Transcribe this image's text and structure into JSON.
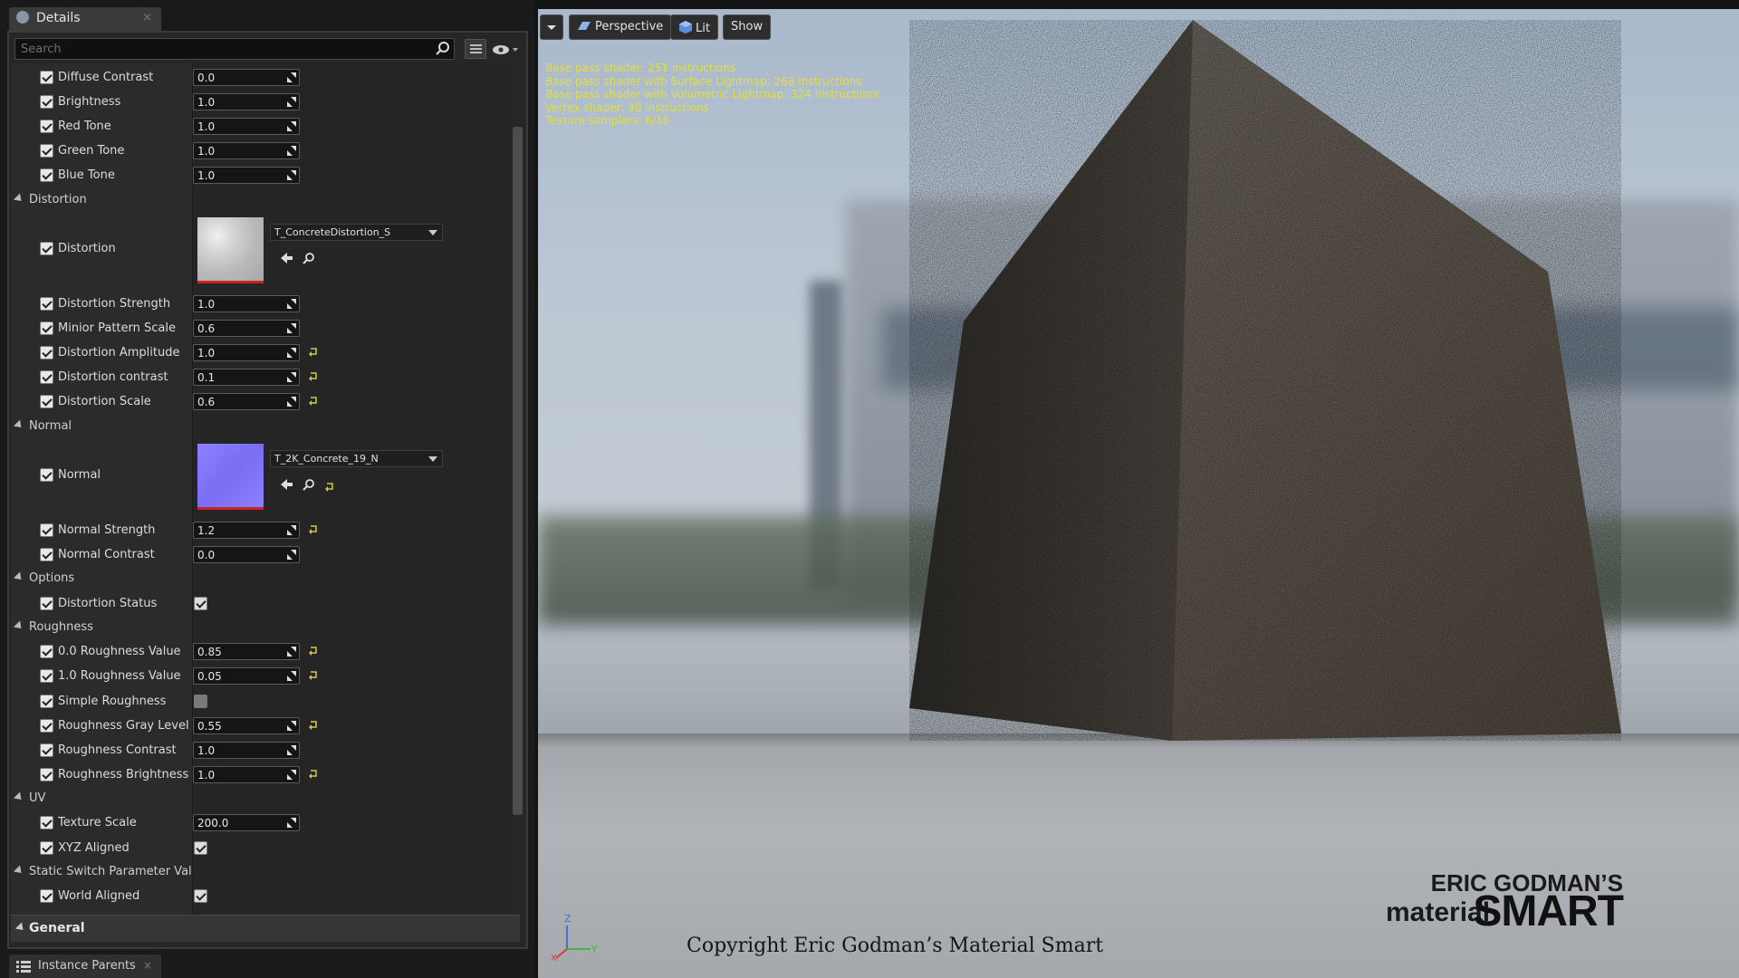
{
  "details_tab": {
    "title": "Details",
    "close": "×"
  },
  "search": {
    "placeholder": "Search"
  },
  "properties": [
    {
      "kind": "row",
      "label": "Diffuse Contrast",
      "type": "number",
      "value": "0.0",
      "reset": false
    },
    {
      "kind": "row",
      "label": "Brightness",
      "type": "number",
      "value": "1.0",
      "reset": false
    },
    {
      "kind": "row",
      "label": "Red Tone",
      "type": "number",
      "value": "1.0",
      "reset": false
    },
    {
      "kind": "row",
      "label": "Green Tone",
      "type": "number",
      "value": "1.0",
      "reset": false
    },
    {
      "kind": "row",
      "label": "Blue Tone",
      "type": "number",
      "value": "1.0",
      "reset": false
    },
    {
      "kind": "category",
      "label": "Distortion"
    },
    {
      "kind": "texture",
      "label": "Distortion",
      "asset": "T_ConcreteDistortion_S",
      "thumb": "concrete",
      "reset": false
    },
    {
      "kind": "row",
      "label": "Distortion Strength",
      "type": "number",
      "value": "1.0",
      "reset": false
    },
    {
      "kind": "row",
      "label": "Minior Pattern Scale",
      "type": "number",
      "value": "0.6",
      "reset": false
    },
    {
      "kind": "row",
      "label": "Distortion Amplitude",
      "type": "number",
      "value": "1.0",
      "reset": true
    },
    {
      "kind": "row",
      "label": "Distortion contrast",
      "type": "number",
      "value": "0.1",
      "reset": true
    },
    {
      "kind": "row",
      "label": "Distortion Scale",
      "type": "number",
      "value": "0.6",
      "reset": true
    },
    {
      "kind": "category",
      "label": "Normal"
    },
    {
      "kind": "texture",
      "label": "Normal",
      "asset": "T_2K_Concrete_19_N",
      "thumb": "normal",
      "reset": true
    },
    {
      "kind": "row",
      "label": "Normal Strength",
      "type": "number",
      "value": "1.2",
      "reset": true
    },
    {
      "kind": "row",
      "label": "Normal Contrast",
      "type": "number",
      "value": "0.0",
      "reset": false
    },
    {
      "kind": "category",
      "label": "Options"
    },
    {
      "kind": "row",
      "label": "Distortion Status",
      "type": "bool",
      "value": true,
      "reset": false
    },
    {
      "kind": "category",
      "label": "Roughness"
    },
    {
      "kind": "row",
      "label": "0.0 Roughness Value",
      "type": "number",
      "value": "0.85",
      "reset": true
    },
    {
      "kind": "row",
      "label": "1.0 Roughness Value",
      "type": "number",
      "value": "0.05",
      "reset": true
    },
    {
      "kind": "row",
      "label": "Simple Roughness",
      "type": "bool",
      "value": false,
      "reset": false
    },
    {
      "kind": "row",
      "label": "Roughness Gray Level",
      "type": "number",
      "value": "0.55",
      "reset": true
    },
    {
      "kind": "row",
      "label": "Roughness Contrast",
      "type": "number",
      "value": "1.0",
      "reset": false
    },
    {
      "kind": "row",
      "label": "Roughness Brightness",
      "type": "number",
      "value": "1.0",
      "reset": true
    },
    {
      "kind": "category",
      "label": "UV"
    },
    {
      "kind": "row",
      "label": "Texture Scale",
      "type": "number",
      "value": "200.0",
      "reset": false
    },
    {
      "kind": "row",
      "label": "XYZ Aligned",
      "type": "bool",
      "value": true,
      "reset": false
    },
    {
      "kind": "category",
      "label": "Static Switch Parameter Value"
    },
    {
      "kind": "row",
      "label": "World Aligned",
      "type": "bool",
      "value": true,
      "reset": false
    }
  ],
  "general": {
    "label": "General"
  },
  "bottom_tab": {
    "title": "Instance Parents",
    "close": "×"
  },
  "viewport": {
    "toolbar": {
      "perspective": "Perspective",
      "lit": "Lit",
      "show": "Show"
    },
    "stats": [
      "Base pass shader: 251 instructions",
      "Base pass shader with Surface Lightmap: 268 instructions",
      "Base pass shader with Volumetric Lightmap: 324 instructions",
      "Vertex shader: 30 instructions",
      "Texture samplers: 6/16"
    ],
    "axis": {
      "z": "Z",
      "x": "X",
      "y": "Y"
    },
    "copyright": "Copyright Eric Godman’s Material Smart",
    "logo": {
      "line1": "ERIC GODMAN’S",
      "line2": "material",
      "line3": "SMART"
    }
  },
  "colors": {
    "stats_text": "#e3df3a",
    "reset_arrow": "#d4c84a",
    "accent_selected": "#4a7fd0"
  }
}
